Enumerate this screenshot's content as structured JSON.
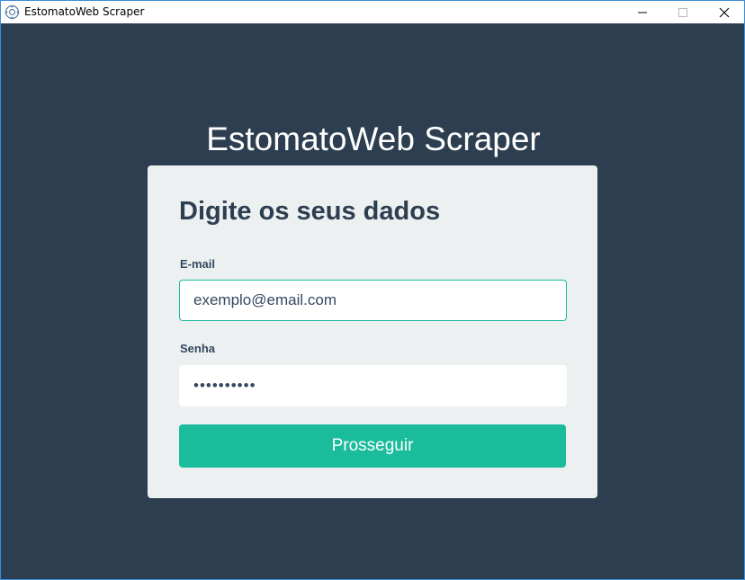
{
  "window": {
    "title": "EstomatoWeb Scraper",
    "icon": "app-logo-icon"
  },
  "app": {
    "title": "EstomatoWeb Scraper"
  },
  "form": {
    "heading": "Digite os seus dados",
    "email_label": "E-mail",
    "email_value": "exemplo@email.com",
    "password_label": "Senha",
    "password_value": "••••••••••",
    "submit_label": "Prosseguir"
  },
  "colors": {
    "background": "#2c3e50",
    "card": "#ecf0f1",
    "accent": "#1abc9c"
  }
}
